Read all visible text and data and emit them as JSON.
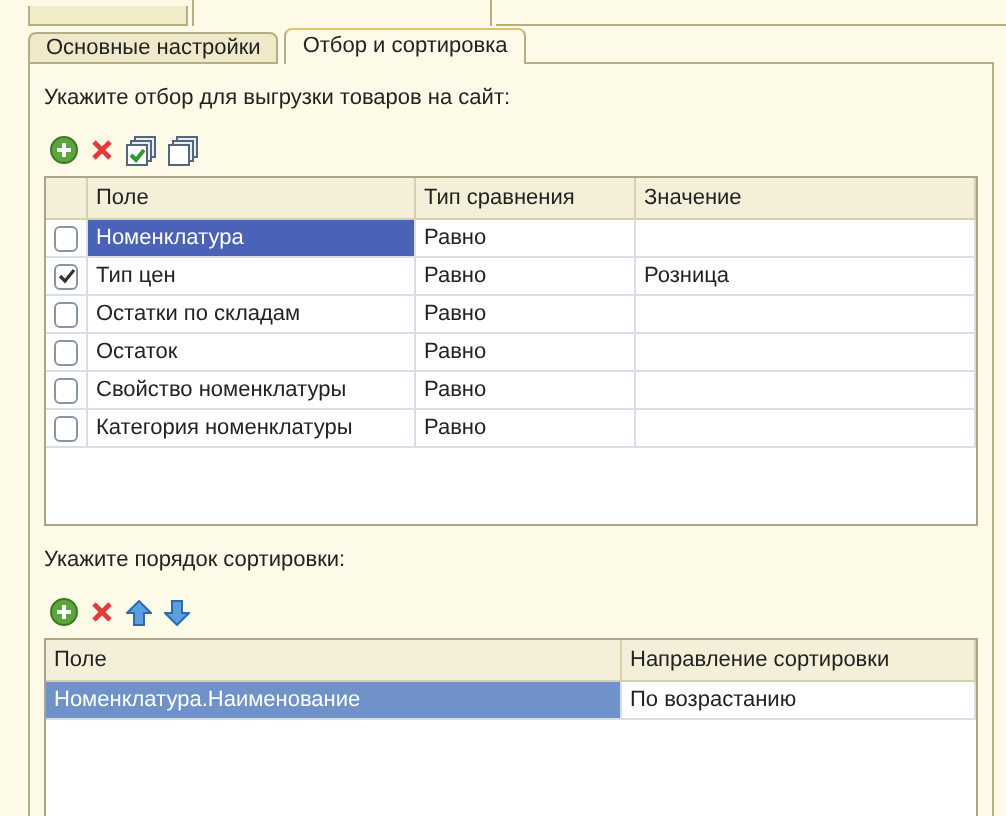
{
  "outer_tabs": [
    {
      "selected": false
    },
    {
      "selected": true
    }
  ],
  "inner_tabs": [
    {
      "label": "Основные настройки",
      "selected": false
    },
    {
      "label": "Отбор и сортировка",
      "selected": true
    }
  ],
  "filter": {
    "label": "Укажите отбор для выгрузки товаров на сайт:",
    "toolbar": [
      {
        "kind": "add"
      },
      {
        "kind": "delete"
      },
      {
        "kind": "check_all"
      },
      {
        "kind": "uncheck_all"
      }
    ],
    "columns": [
      "Поле",
      "Тип сравнения",
      "Значение"
    ],
    "rows": [
      {
        "checked": false,
        "selected": true,
        "field": "Номенклатура",
        "comparison": "Равно"
      },
      {
        "checked": true,
        "selected": false,
        "field": "Тип цен",
        "comparison": "Равно",
        "value": "Розница"
      },
      {
        "checked": false,
        "selected": false,
        "field": "Остатки по складам",
        "comparison": "Равно"
      },
      {
        "checked": false,
        "selected": false,
        "field": "Остаток",
        "comparison": "Равно"
      },
      {
        "checked": false,
        "selected": false,
        "field": "Свойство номенклатуры",
        "comparison": "Равно"
      },
      {
        "checked": false,
        "selected": false,
        "field": "Категория номенклатуры",
        "comparison": "Равно"
      }
    ]
  },
  "sort": {
    "label": "Укажите порядок сортировки:",
    "toolbar": [
      {
        "kind": "add"
      },
      {
        "kind": "delete"
      },
      {
        "kind": "up"
      },
      {
        "kind": "down"
      }
    ],
    "columns": [
      "Поле",
      "Направление сортировки"
    ],
    "rows": [
      {
        "selected": true,
        "field": "Номенклатура.Наименование",
        "direction": "По возрастанию"
      }
    ]
  }
}
